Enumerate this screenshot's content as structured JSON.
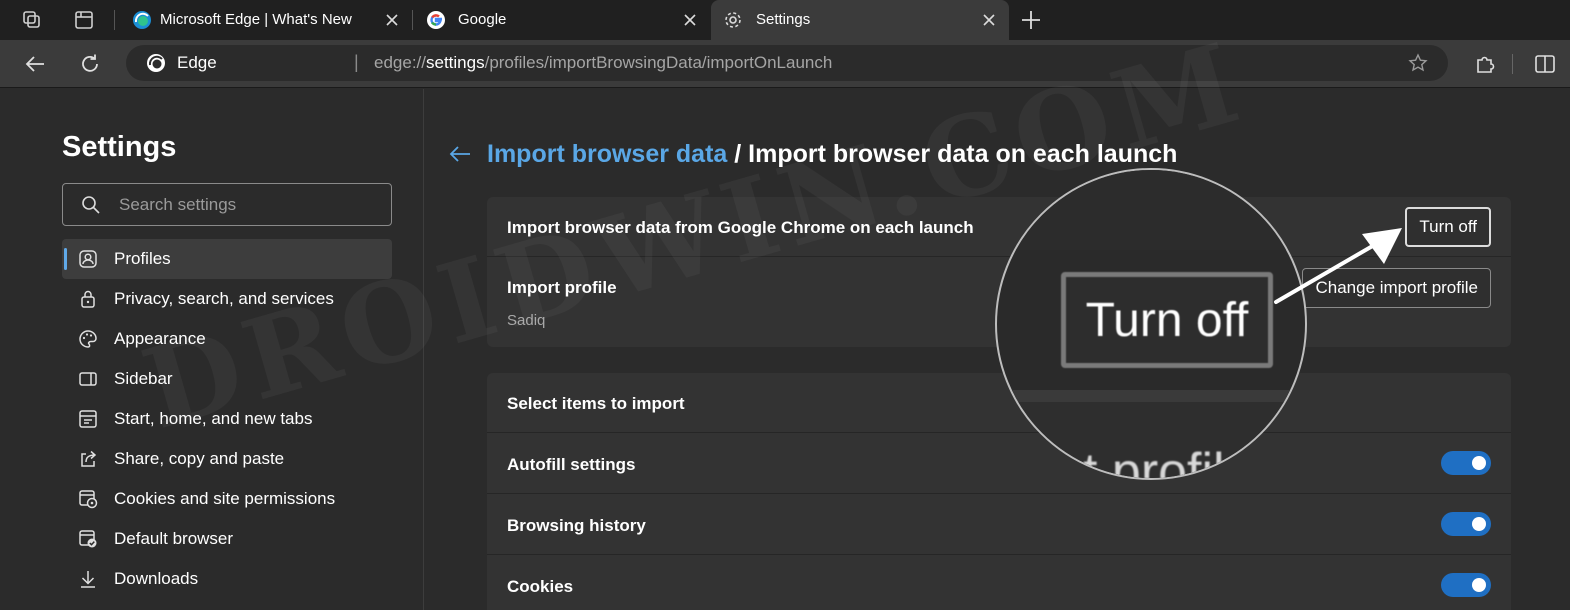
{
  "tabs": [
    {
      "title": "Microsoft Edge | What's New",
      "favicon": "edge-icon"
    },
    {
      "title": "Google",
      "favicon": "google-icon"
    },
    {
      "title": "Settings",
      "favicon": "gear-icon",
      "active": true
    }
  ],
  "address_bar": {
    "brand": "Edge",
    "url_host": "edge://",
    "url_highlight": "settings",
    "url_path": "/profiles/importBrowsingData/importOnLaunch"
  },
  "sidebar": {
    "title": "Settings",
    "search_placeholder": "Search settings",
    "items": [
      {
        "label": "Profiles",
        "icon": "profile-icon",
        "active": true
      },
      {
        "label": "Privacy, search, and services",
        "icon": "lock-icon"
      },
      {
        "label": "Appearance",
        "icon": "palette-icon"
      },
      {
        "label": "Sidebar",
        "icon": "sidebar-icon"
      },
      {
        "label": "Start, home, and new tabs",
        "icon": "home-tabs-icon"
      },
      {
        "label": "Share, copy and paste",
        "icon": "share-icon"
      },
      {
        "label": "Cookies and site permissions",
        "icon": "cookies-icon"
      },
      {
        "label": "Default browser",
        "icon": "browser-icon"
      },
      {
        "label": "Downloads",
        "icon": "download-icon"
      }
    ]
  },
  "main": {
    "breadcrumb_link": "Import browser data",
    "breadcrumb_sep": " / ",
    "breadcrumb_current": "Import browser data on each launch",
    "import_row_label": "Import browser data from Google Chrome on each launch",
    "turn_off_label": "Turn off",
    "profile_label": "Import profile",
    "profile_value": "Sadiq",
    "change_profile_label": "Change import profile",
    "select_items_label": "Select items to import",
    "toggles": [
      {
        "label": "Autofill settings",
        "on": true
      },
      {
        "label": "Browsing history",
        "on": true
      },
      {
        "label": "Cookies",
        "on": true
      }
    ]
  },
  "magnifier": {
    "button_label": "Turn off",
    "fragment": "t profil"
  },
  "watermark": "DROIDWIN.COM",
  "colors": {
    "accent": "#5aa7e6",
    "toggle_on": "#1f6fc3",
    "background": "#2b2b2b",
    "card": "#333333"
  }
}
